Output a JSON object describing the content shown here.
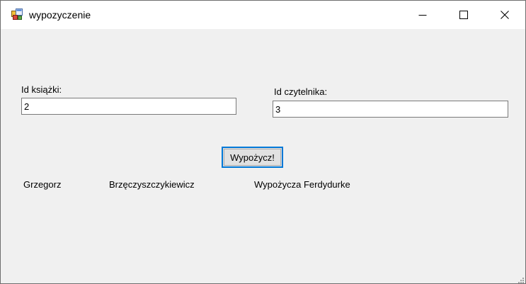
{
  "window": {
    "title": "wypozyczenie",
    "icon": "windows-form-icon",
    "controls": {
      "minimize_icon": "minimize-icon",
      "maximize_icon": "maximize-icon",
      "close_icon": "close-icon"
    }
  },
  "form": {
    "book_id": {
      "label": "Id książki:",
      "value": "2"
    },
    "reader_id": {
      "label": "Id czytelnika:",
      "value": "3"
    },
    "submit_label": "Wypożycz!"
  },
  "result": {
    "first_name": "Grzegorz",
    "last_name": "Brzęczyszczykiewicz",
    "message": "Wypożycza Ferdydurke"
  },
  "colors": {
    "window_background": "#f0f0f0",
    "titlebar_background": "#ffffff",
    "button_focus_border": "#0078d7",
    "button_background": "#e1e1e1"
  }
}
